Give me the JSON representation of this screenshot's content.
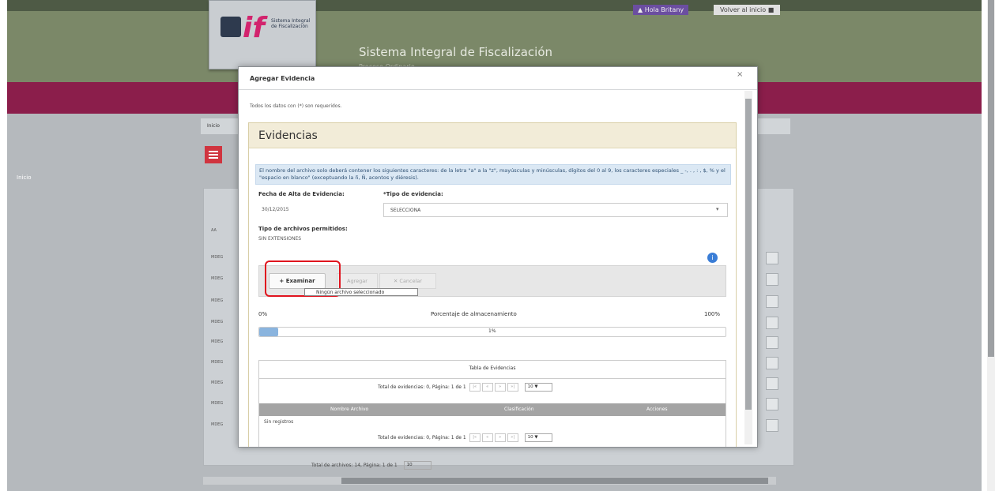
{
  "app": {
    "logo_letters": "if",
    "logo_text": "Sistema Integral de Fiscalización",
    "title": "Sistema Integral de Fiscalización",
    "subtitle": "Proceso Ordinario",
    "user_label": "▲ Hola Britany",
    "return_label": "Volver al inicio ■",
    "nav_home": "Inicio",
    "breadcrumb": "Inicio",
    "background_rows": [
      "AA",
      "MDEG",
      "MDEG",
      "MDEG",
      "MDEG",
      "MDEG",
      "MDEG",
      "MDEG",
      "MDEG",
      "MDEG"
    ],
    "background_pager": "Total de archivos: 14, Página: 1 de 1",
    "background_pager_size": "10"
  },
  "modal": {
    "title": "Agregar Evidencia",
    "close": "×",
    "required_note": "Todos los datos con (*) son requeridos.",
    "card_title": "Evidencias",
    "notice": "El nombre del archivo solo deberá contener los siguientes caracteres: de la letra \"a\" a la \"z\", mayúsculas y minúsculas, dígitos del 0 al 9, los caracteres especiales _ -, . , : , $, % y el \"espacio en blanco\" (exceptuando la ñ, Ñ, acentos y diéresis).",
    "fecha_label": "Fecha de Alta de Evidencia:",
    "fecha_value": "30/12/2015",
    "tipo_label": "*Tipo de evidencia:",
    "tipo_value": "SELECCIONA",
    "permitidos_label": "Tipo de archivos permitidos:",
    "permitidos_value": "SIN EXTENSIONES",
    "info_icon": "i",
    "examinar_label": "+ Examinar",
    "agregar_label": "Agregar",
    "cancelar_label": "✕ Cancelar",
    "tooltip": "Ningún archivo seleccionado",
    "pct_min": "0%",
    "pct_label": "Porcentaje de almacenamiento",
    "pct_max": "100%",
    "progress": {
      "fraction": 0.04,
      "text": "1%"
    },
    "table": {
      "caption": "Tabla de Evidencias",
      "pager_text": "Total de evidencias: 0, Página: 1 de 1",
      "page_size": "10 ▼",
      "columns": [
        "Nombre Archivo",
        "Clasificación",
        "Acciones"
      ],
      "empty": "Sin registros"
    }
  },
  "colors": {
    "nav": "#8b1e4b",
    "header": "#7b8868",
    "highlight": "#e0141e",
    "accent": "#3a7dd6"
  }
}
